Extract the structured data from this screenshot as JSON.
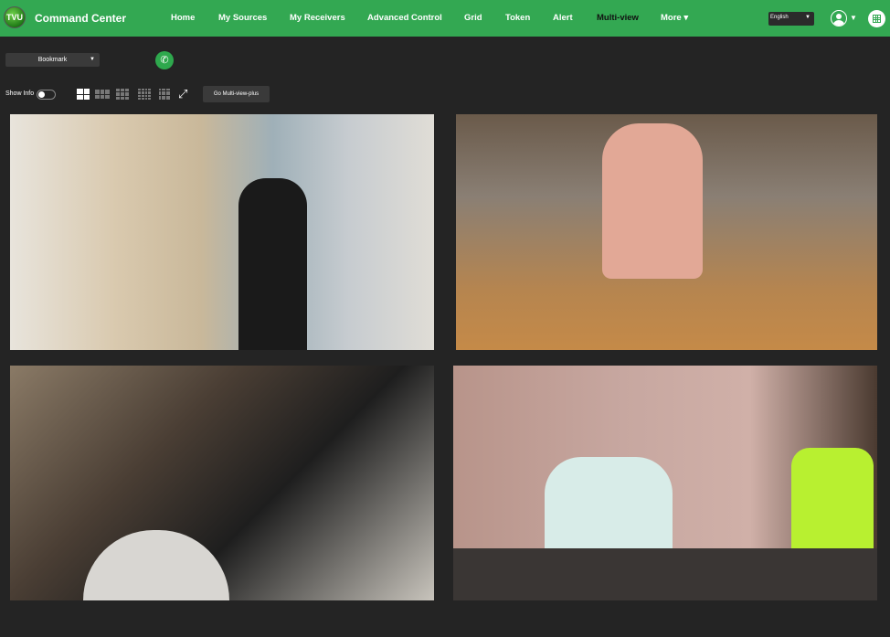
{
  "header": {
    "logo_text": "TVU",
    "title": "Command Center",
    "nav": [
      {
        "label": "Home"
      },
      {
        "label": "My Sources"
      },
      {
        "label": "My Receivers"
      },
      {
        "label": "Advanced Control"
      },
      {
        "label": "Grid"
      },
      {
        "label": "Token"
      },
      {
        "label": "Alert"
      },
      {
        "label": "Multi-view",
        "active": true
      },
      {
        "label": "More ▾"
      }
    ],
    "language": "English",
    "accent": "#33a852"
  },
  "toolbar": {
    "bookmark": "Bookmark",
    "show_info": "Show Info",
    "show_info_on": false,
    "go_multiview_plus": "Go Multi-view-plus",
    "layouts": [
      "1x1",
      "2x2",
      "3x3",
      "4x4",
      "5x5"
    ],
    "active_layout": "2x2"
  },
  "tiles": [
    {
      "icon": "video-feed"
    },
    {
      "icon": "video-feed"
    },
    {
      "icon": "video-feed"
    },
    {
      "icon": "video-feed"
    }
  ]
}
